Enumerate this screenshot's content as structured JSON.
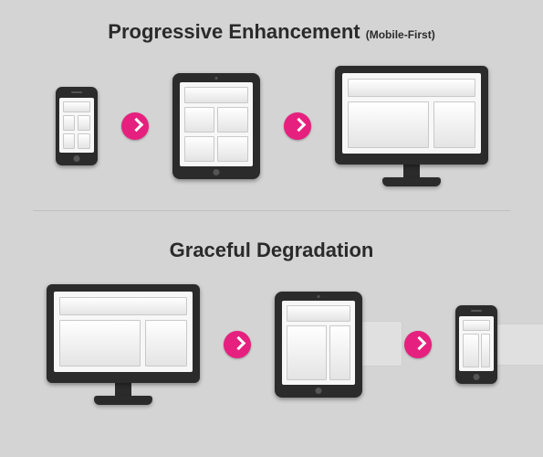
{
  "top": {
    "title": "Progressive Enhancement",
    "subtitle": "(Mobile-First)"
  },
  "bottom": {
    "title": "Graceful Degradation"
  },
  "colors": {
    "background": "#d4d4d4",
    "device": "#2b2b2b",
    "arrow": "#e6207e"
  },
  "icons": {
    "arrow": "chevron-right",
    "phone": "smartphone-icon",
    "tablet": "tablet-icon",
    "monitor": "desktop-monitor-icon"
  }
}
